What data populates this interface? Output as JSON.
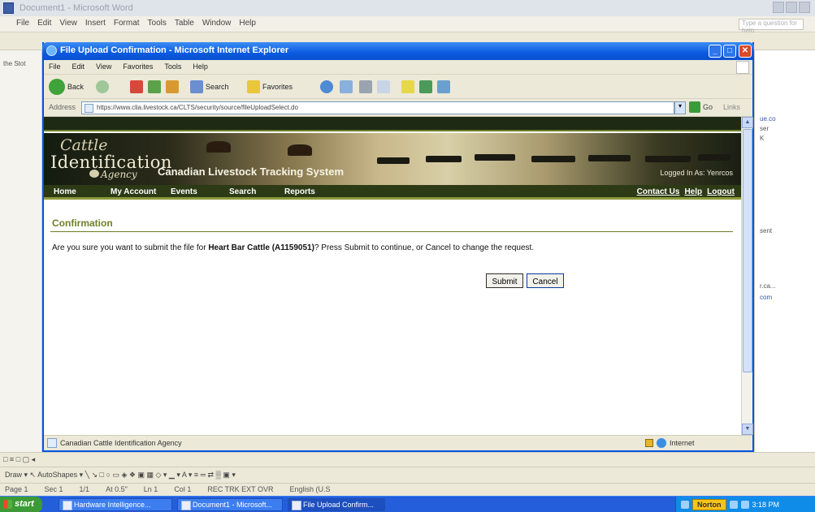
{
  "word": {
    "title": "Document1 - Microsoft Word",
    "menu": [
      "File",
      "Edit",
      "View",
      "Insert",
      "Format",
      "Tools",
      "Table",
      "Window",
      "Help"
    ],
    "help_placeholder": "Type a question for help",
    "status": "□ ≡ □ ▢ ◂",
    "drawbar": "Draw ▾  ↖  AutoShapes ▾  ╲  ↘  □  ○  ▭  ◈  ❖  ▣  ▦  ◇ ▾  ▁ ▾  A ▾  ≡  ═  ⇄  ▒  ▣ ▾",
    "page_info": [
      "Page 1",
      "Sec 1",
      "1/1",
      "At 0.5\"",
      "Ln 1",
      "Col 1",
      "REC  TRK  EXT  OVR",
      "English (U.S"
    ],
    "right_snips": [
      "ue.co",
      "ser",
      "K",
      "sent",
      "r.ca...",
      "com"
    ],
    "left_snips": [
      "the Stot"
    ]
  },
  "ie": {
    "title": "File Upload Confirmation - Microsoft Internet Explorer",
    "menu": [
      "File",
      "Edit",
      "View",
      "Favorites",
      "Tools",
      "Help"
    ],
    "toolbar": {
      "back": "Back",
      "search": "Search",
      "favorites": "Favorites"
    },
    "address_label": "Address",
    "url": "https://www.clia.livestock.ca/CLTS/security/source/fileUploadSelect.do",
    "go": "Go",
    "links": "Links",
    "status_text": "Canadian Cattle Identification Agency",
    "zone": "Internet"
  },
  "site": {
    "logo_cattle": "Cattle",
    "logo_identification": "Identification",
    "logo_agency": "Agency",
    "system_title": "Canadian Livestock Tracking System",
    "logged_in": "Logged In As: Yenrcos",
    "nav": [
      "Home",
      "My Account",
      "Events",
      "Search",
      "Reports"
    ],
    "nav_right": [
      "Contact Us",
      "Help",
      "Logout"
    ],
    "confirm_heading": "Confirmation",
    "confirm_msg_pre": "Are you sure you want to submit the file for ",
    "confirm_msg_bold": "Heart Bar Cattle (A1159051)",
    "confirm_msg_post": "? Press Submit to continue, or Cancel to change the request.",
    "submit_label": "Submit",
    "cancel_label": "Cancel"
  },
  "taskbar": {
    "start": "start",
    "tasks": [
      "Hardware Intelligence...",
      "Document1 - Microsoft...",
      "File Upload Confirm..."
    ],
    "tray_norton": "Norton",
    "time": "3:18 PM"
  },
  "colors": {
    "ie_titlebar": "#0a5be0",
    "site_nav": "#2d3a16",
    "site_accent": "#6e7f2a",
    "taskbar": "#245edb"
  }
}
